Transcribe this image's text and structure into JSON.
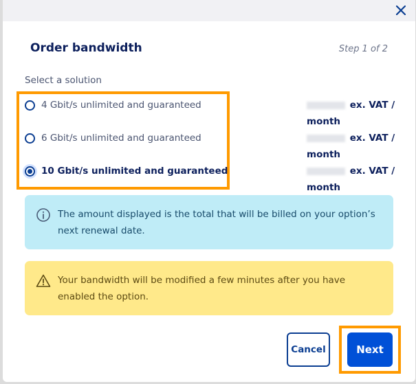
{
  "dialog": {
    "title": "Order bandwidth",
    "step": "Step 1 of 2",
    "close_icon": "close-icon"
  },
  "solution": {
    "label": "Select a solution",
    "options": [
      {
        "label": "4 Gbit/s unlimited and guaranteed",
        "selected": false,
        "price_suffix": "ex. VAT /",
        "price_period": "month"
      },
      {
        "label": "6 Gbit/s unlimited and guaranteed",
        "selected": false,
        "price_suffix": "ex. VAT /",
        "price_period": "month"
      },
      {
        "label": "10 Gbit/s unlimited and guaranteed",
        "selected": true,
        "price_suffix": "ex. VAT /",
        "price_period": "month"
      }
    ]
  },
  "info": {
    "icon": "info-icon",
    "text": "The amount displayed is the total that will be billed on your option’s next renewal date."
  },
  "warning": {
    "icon": "warning-icon",
    "text": "Your bandwidth will be modified a few minutes after you have enabled the option."
  },
  "actions": {
    "cancel_label": "Cancel",
    "next_label": "Next"
  },
  "colors": {
    "accent": "#0050d7",
    "highlight": "#ff9a00",
    "info_bg": "#bfecf7",
    "warning_bg": "#ffe98a"
  }
}
